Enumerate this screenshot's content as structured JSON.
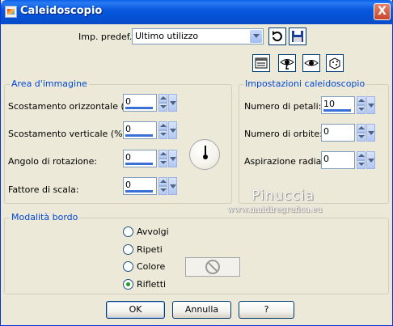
{
  "window": {
    "title": "Caleidoscopio",
    "close_label": "X"
  },
  "preset": {
    "label": "Imp. predef.:",
    "value": "Ultimo utilizzo"
  },
  "toolbar_icons": [
    "reset-icon",
    "save-icon",
    "properties-icon",
    "proof-icon",
    "preview-icon",
    "randomize-icon"
  ],
  "area_immagine": {
    "title": "Area d'immagine",
    "fields": [
      {
        "label": "Scostamento orizzontale (%):",
        "value": "0"
      },
      {
        "label": "Scostamento verticale (%):",
        "value": "0"
      },
      {
        "label": "Angolo di rotazione:",
        "value": "0"
      },
      {
        "label": "Fattore di scala:",
        "value": "0"
      }
    ]
  },
  "impostazioni": {
    "title": "Impostazioni caleidoscopio",
    "fields": [
      {
        "label": "Numero di petali:",
        "value": "10"
      },
      {
        "label": "Numero di orbite:",
        "value": "0"
      },
      {
        "label": "Aspirazione radiale:",
        "value": "0"
      }
    ]
  },
  "watermark": {
    "line1": "Pinuccia",
    "line2": "www.maidiregrafica.eu"
  },
  "modalita": {
    "title": "Modalità bordo",
    "options": [
      {
        "label": "Avvolgi",
        "selected": false
      },
      {
        "label": "Ripeti",
        "selected": false
      },
      {
        "label": "Colore",
        "selected": false
      },
      {
        "label": "Rifletti",
        "selected": true
      }
    ]
  },
  "buttons": {
    "ok": "OK",
    "cancel": "Annulla",
    "help": "?"
  }
}
